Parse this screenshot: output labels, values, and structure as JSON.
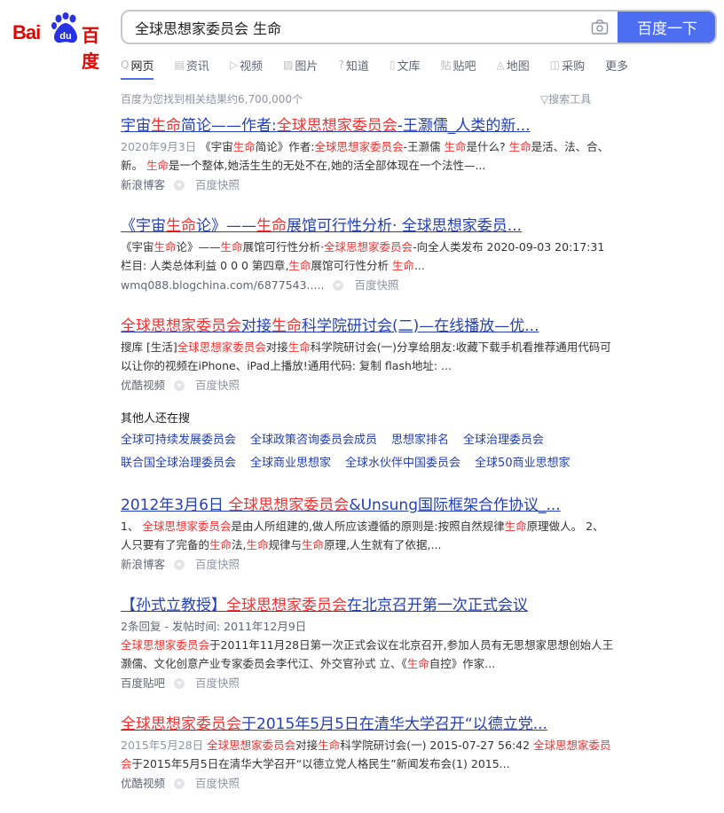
{
  "logo": {
    "text": "Bai du 百度"
  },
  "search": {
    "query": "全球思想家委员会 生命",
    "button": "百度一下",
    "camera_icon": "camera-icon"
  },
  "tabs": [
    {
      "label": "网页",
      "icon": "Q",
      "active": true
    },
    {
      "label": "资讯",
      "icon": "▤"
    },
    {
      "label": "视频",
      "icon": "▷"
    },
    {
      "label": "图片",
      "icon": "▨"
    },
    {
      "label": "知道",
      "icon": "?"
    },
    {
      "label": "文库",
      "icon": "▯"
    },
    {
      "label": "贴吧",
      "icon": "贴"
    },
    {
      "label": "地图",
      "icon": "◬"
    },
    {
      "label": "采购",
      "icon": "◫"
    },
    {
      "label": "更多",
      "icon": ""
    }
  ],
  "stats": "百度为您找到相关结果约6,700,000个",
  "search_tools": "搜索工具",
  "results": [
    {
      "title": [
        {
          "t": "宇宙"
        },
        {
          "t": "生命",
          "hl": 1
        },
        {
          "t": "简论——作者:"
        },
        {
          "t": "全球思想家委员会",
          "hl": 1
        },
        {
          "t": "-王灏儒_人类的新..."
        }
      ],
      "abstract": [
        {
          "t": "2020年9月3日 ",
          "date": 1
        },
        {
          "t": "《宇宙"
        },
        {
          "t": "生命",
          "hl": 1
        },
        {
          "t": "简论》作者:"
        },
        {
          "t": "全球思想家委员会",
          "hl": 1
        },
        {
          "t": "-王灏儒 "
        },
        {
          "t": "生命",
          "hl": 1
        },
        {
          "t": "是什么? "
        },
        {
          "t": "生命",
          "hl": 1
        },
        {
          "t": "是活、法、合、新。 "
        },
        {
          "t": "生命",
          "hl": 1
        },
        {
          "t": "是一个整体,她活生生的无处不在,她的活全部体现在一个法性—..."
        }
      ],
      "source": "新浪博客",
      "snapshot": "百度快照"
    },
    {
      "title": [
        {
          "t": "《宇宙"
        },
        {
          "t": "生命",
          "hl": 1
        },
        {
          "t": "论》——"
        },
        {
          "t": "生命",
          "hl": 1
        },
        {
          "t": "展馆可行性分析· 全球思想家委员..."
        }
      ],
      "abstract": [
        {
          "t": "《宇宙"
        },
        {
          "t": "生命",
          "hl": 1
        },
        {
          "t": "论》——"
        },
        {
          "t": "生命",
          "hl": 1
        },
        {
          "t": "展馆可行性分析·"
        },
        {
          "t": "全球思想家委员会",
          "hl": 1
        },
        {
          "t": "-向全人类发布 2020-09-03 20:17:31 栏目: 人类总体利益 0 0 0 第四章,"
        },
        {
          "t": "生命",
          "hl": 1
        },
        {
          "t": "展馆可行性分析 "
        },
        {
          "t": "生命",
          "hl": 1
        },
        {
          "t": "..."
        }
      ],
      "source": "wmq088.blogchina.com/6877543.....",
      "snapshot": "百度快照"
    },
    {
      "title": [
        {
          "t": "全球思想家委员会",
          "hl": 1
        },
        {
          "t": "对接"
        },
        {
          "t": "生命",
          "hl": 1
        },
        {
          "t": "科学院研讨会(二)—在线播放—优..."
        }
      ],
      "abstract": [
        {
          "t": "搜库 [生活]"
        },
        {
          "t": "全球思想家委员会",
          "hl": 1
        },
        {
          "t": "对接"
        },
        {
          "t": "生命",
          "hl": 1
        },
        {
          "t": "科学院研讨会(一)分享给朋友:收藏下载手机看推荐通用代码可以让你的视频在iPhone、iPad上播放!通用代码: 复制 flash地址: ..."
        }
      ],
      "source": "优酷视频",
      "snapshot": "百度快照"
    }
  ],
  "related": {
    "heading": "其他人还在搜",
    "rows": [
      [
        "全球可持续发展委员会",
        "全球政策咨询委员会成员",
        "思想家排名",
        "全球治理委员会"
      ],
      [
        "联合国全球治理委员会",
        "全球商业思想家",
        "全球水伙伴中国委员会",
        "全球50商业思想家"
      ]
    ]
  },
  "results2": [
    {
      "title": [
        {
          "t": "2012年3月6日 "
        },
        {
          "t": "全球思想家委员会",
          "hl": 1
        },
        {
          "t": "&Unsung国际框架合作协议_..."
        }
      ],
      "abstract": [
        {
          "t": "1、 "
        },
        {
          "t": "全球思想家委员会",
          "hl": 1
        },
        {
          "t": "是由人所组建的,做人所应该遵循的原则是:按照自然规律"
        },
        {
          "t": "生命",
          "hl": 1
        },
        {
          "t": "原理做人。 2、 人只要有了完备的"
        },
        {
          "t": "生命",
          "hl": 1
        },
        {
          "t": "法,"
        },
        {
          "t": "生命",
          "hl": 1
        },
        {
          "t": "规律与"
        },
        {
          "t": "生命",
          "hl": 1
        },
        {
          "t": "原理,人生就有了依据,..."
        }
      ],
      "source": "新浪博客",
      "snapshot": "百度快照"
    },
    {
      "title": [
        {
          "t": "【孙式立教授】"
        },
        {
          "t": "全球思想家委员会",
          "hl": 1
        },
        {
          "t": "在北京召开第一次正式会议"
        }
      ],
      "meta": "2条回复 - 发帖时间: 2011年12月9日",
      "abstract": [
        {
          "t": "全球思想家委员会",
          "hl": 1
        },
        {
          "t": "于2011年11月28日第一次正式会议在北京召开,参加人员有无思想家思想创始人王灏儒、文化创意产业专家委员会李代江、外交官孙式 立、《"
        },
        {
          "t": "生命",
          "hl": 1
        },
        {
          "t": "自控》作家..."
        }
      ],
      "source": "百度贴吧",
      "snapshot": "百度快照"
    },
    {
      "title": [
        {
          "t": "全球思想家委员会",
          "hl": 1
        },
        {
          "t": "于2015年5月5日在清华大学召开“以德立党..."
        }
      ],
      "abstract": [
        {
          "t": "2015年5月28日 ",
          "date": 1
        },
        {
          "t": "全球思想家委员会",
          "hl": 1
        },
        {
          "t": "对接"
        },
        {
          "t": "生命",
          "hl": 1
        },
        {
          "t": "科学院研讨会(一) 2015-07-27 56:42 "
        },
        {
          "t": "全球思想家委员会",
          "hl": 1
        },
        {
          "t": "于2015年5月5日在清华大学召开“以德立党人格民生”新闻发布会(1) 2015..."
        }
      ],
      "source": "优酷视频",
      "snapshot": "百度快照"
    }
  ]
}
